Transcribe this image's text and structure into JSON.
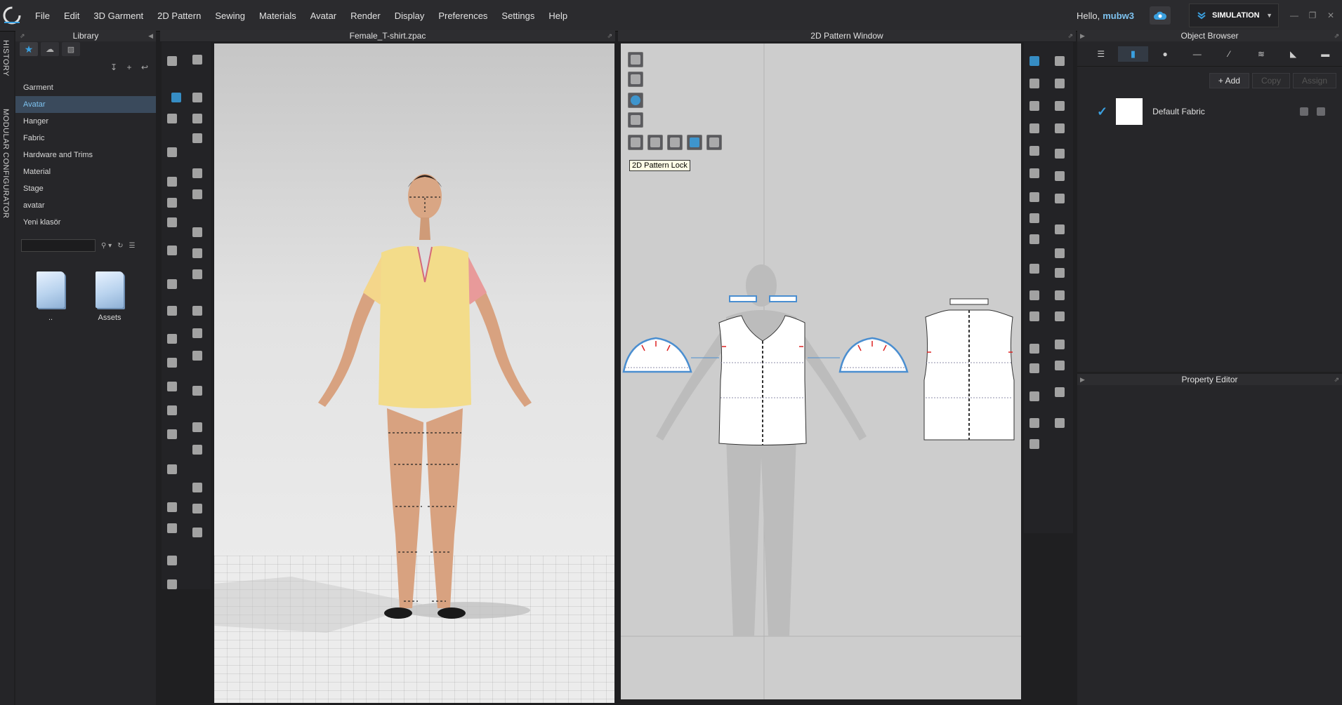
{
  "menubar": {
    "logo_icon": "clo-logo-icon",
    "items": [
      "File",
      "Edit",
      "3D Garment",
      "2D Pattern",
      "Sewing",
      "Materials",
      "Avatar",
      "Render",
      "Display",
      "Preferences",
      "Settings",
      "Help"
    ],
    "greeting": "Hello,",
    "username": "mubw3",
    "mode_label": "SIMULATION"
  },
  "side_tabs": {
    "history": "HISTORY",
    "modular": "MODULAR CONFIGURATOR"
  },
  "library": {
    "title": "Library",
    "items": [
      "Garment",
      "Avatar",
      "Hanger",
      "Fabric",
      "Hardware and Trims",
      "Material",
      "Stage",
      "avatar",
      "Yeni klasör"
    ],
    "selected": "Avatar",
    "folders": [
      "..",
      "Assets"
    ]
  },
  "viewport3d": {
    "title": "Female_T-shirt.zpac"
  },
  "viewport2d": {
    "title": "2D Pattern Window",
    "tooltip": "2D Pattern Lock"
  },
  "object_browser": {
    "title": "Object Browser",
    "add_label": "Add",
    "copy_label": "Copy",
    "assign_label": "Assign",
    "fabric_name": "Default Fabric"
  },
  "property_editor": {
    "title": "Property Editor"
  },
  "colors": {
    "accent": "#3aa0e0",
    "garment": "#f3dc8a",
    "background": "#1f1f21"
  }
}
